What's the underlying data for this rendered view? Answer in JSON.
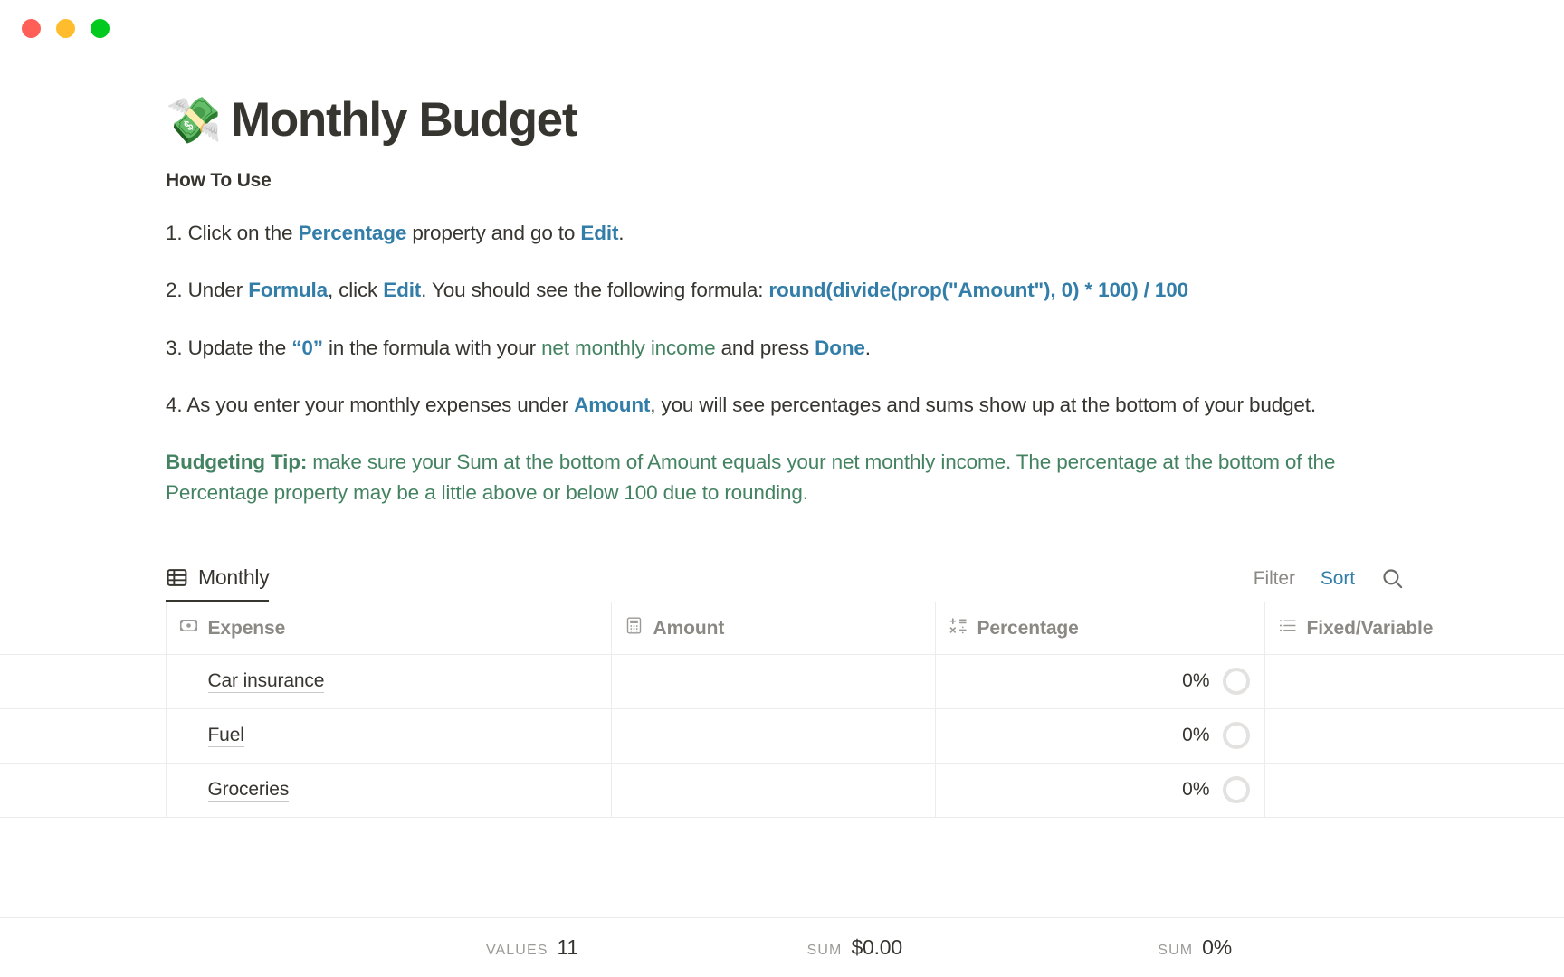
{
  "window": {
    "traffic_lights": [
      {
        "name": "close",
        "color": "#ff5f57"
      },
      {
        "name": "minimize",
        "color": "#ffbd2e"
      },
      {
        "name": "zoom",
        "color": "#00ca1e"
      }
    ]
  },
  "page": {
    "emoji": "💸",
    "title": "Monthly Budget",
    "howto_heading": "How To Use",
    "steps": [
      {
        "number": "1. ",
        "parts": [
          {
            "text": "Click on the ",
            "style": "plain"
          },
          {
            "text": "Percentage",
            "style": "blue"
          },
          {
            "text": " property and go to ",
            "style": "plain"
          },
          {
            "text": "Edit",
            "style": "blue"
          },
          {
            "text": ".",
            "style": "plain"
          }
        ]
      },
      {
        "number": "2. ",
        "parts": [
          {
            "text": "Under ",
            "style": "plain"
          },
          {
            "text": "Formula",
            "style": "blue"
          },
          {
            "text": ", click ",
            "style": "plain"
          },
          {
            "text": "Edit",
            "style": "blue"
          },
          {
            "text": ". You should see the following formula: ",
            "style": "plain"
          },
          {
            "text": "round(divide(prop(\"Amount\"), 0) * 100) / 100",
            "style": "blue"
          }
        ]
      },
      {
        "number": "3. ",
        "parts": [
          {
            "text": "Update the ",
            "style": "plain"
          },
          {
            "text": "“0”",
            "style": "blue"
          },
          {
            "text": " in the formula with your ",
            "style": "plain"
          },
          {
            "text": "net monthly income",
            "style": "green"
          },
          {
            "text": " and press ",
            "style": "plain"
          },
          {
            "text": "Done",
            "style": "blue"
          },
          {
            "text": ".",
            "style": "plain"
          }
        ]
      },
      {
        "number": "4. ",
        "parts": [
          {
            "text": "As you enter your monthly expenses under ",
            "style": "plain"
          },
          {
            "text": "Amount",
            "style": "blue"
          },
          {
            "text": ", you will see percentages and sums show up at the bottom of your budget.",
            "style": "plain"
          }
        ]
      }
    ],
    "tip": {
      "label": "Budgeting Tip:",
      "body": " make sure your Sum at the bottom of Amount equals your net monthly income. The percentage at the bottom of the Percentage property may be a little above or below 100 due to rounding."
    }
  },
  "database": {
    "view_tab": {
      "label": "Monthly",
      "icon": "table-icon"
    },
    "actions": {
      "filter_label": "Filter",
      "sort_label": "Sort",
      "search_icon": "search-icon"
    },
    "columns": [
      {
        "label": "Expense",
        "icon": "title-icon"
      },
      {
        "label": "Amount",
        "icon": "number-icon"
      },
      {
        "label": "Percentage",
        "icon": "formula-icon"
      },
      {
        "label": "Fixed/Variable",
        "icon": "select-icon"
      }
    ],
    "rows": [
      {
        "expense": "Car insurance",
        "amount": "",
        "percentage": "0%",
        "fixed_variable": ""
      },
      {
        "expense": "Fuel",
        "amount": "",
        "percentage": "0%",
        "fixed_variable": ""
      },
      {
        "expense": "Groceries",
        "amount": "",
        "percentage": "0%",
        "fixed_variable": ""
      }
    ],
    "summary": {
      "expense": {
        "label": "Values",
        "value": "11"
      },
      "amount": {
        "label": "Sum",
        "value": "$0.00"
      },
      "percentage": {
        "label": "Sum",
        "value": "0%"
      }
    }
  },
  "colors": {
    "blue": "#337ea9",
    "green": "#448361",
    "text": "#37352f",
    "muted": "#8b8984",
    "border": "#ececeb"
  }
}
